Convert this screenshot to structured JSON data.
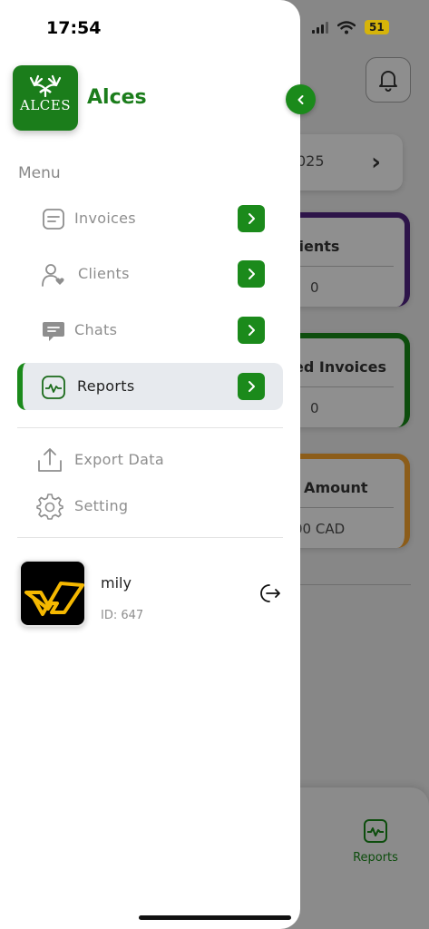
{
  "status": {
    "time": "17:54",
    "battery": "51"
  },
  "background": {
    "date_fragment": "025",
    "cards": [
      {
        "title": "lients",
        "value": "0"
      },
      {
        "title": "ed Invoices",
        "value": "0"
      },
      {
        "title": "l Amount",
        "value": "00 CAD"
      }
    ],
    "bottom_nav": {
      "active_label": "Reports"
    }
  },
  "drawer": {
    "brand": {
      "logo_text": "ALCES",
      "name": "Alces"
    },
    "menu_title": "Menu",
    "menu_items": [
      {
        "label": "Invoices",
        "icon": "invoice-icon",
        "active": false
      },
      {
        "label": "Clients",
        "icon": "clients-icon",
        "active": false
      },
      {
        "label": "Chats",
        "icon": "chat-icon",
        "active": false
      },
      {
        "label": "Reports",
        "icon": "reports-icon",
        "active": true
      }
    ],
    "secondary_items": [
      {
        "label": "Export Data",
        "icon": "export-icon"
      },
      {
        "label": "Setting",
        "icon": "gear-icon"
      }
    ],
    "profile": {
      "name": "mily",
      "id": "ID: 647"
    }
  },
  "colors": {
    "accent": "#1B8A1B",
    "brand_text": "#1B7D1B",
    "active_bg": "#E7EAEE"
  }
}
